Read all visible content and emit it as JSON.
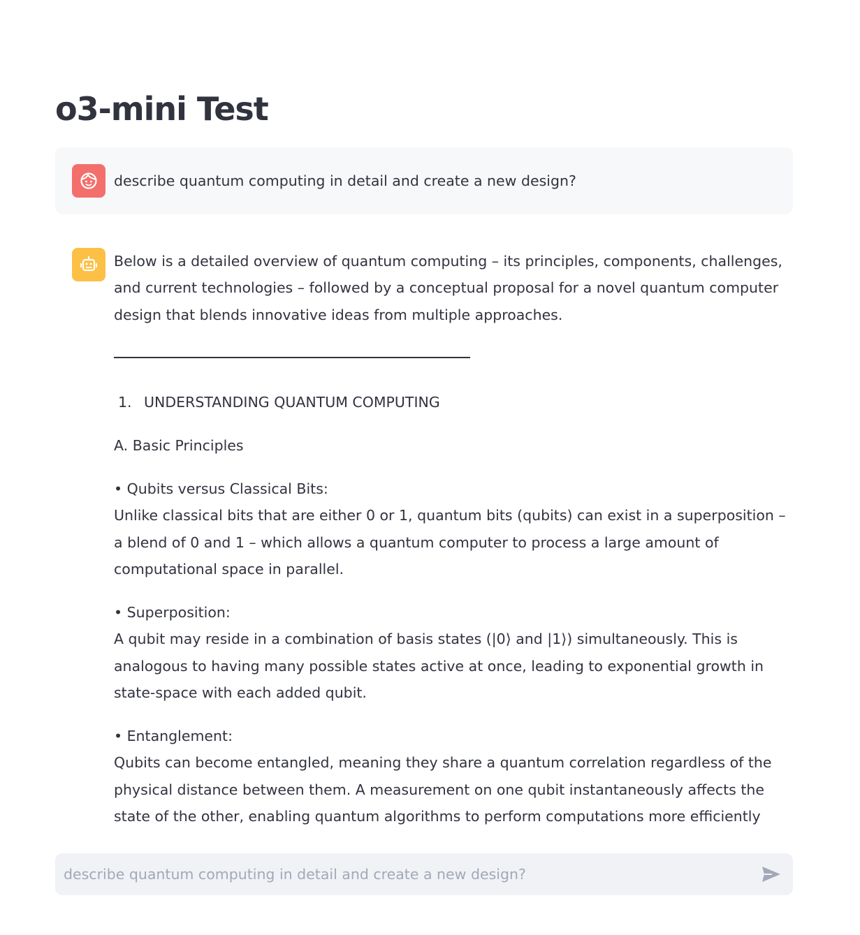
{
  "app": {
    "title": "o3-mini Test"
  },
  "colors": {
    "user_avatar": "#f36f6b",
    "bot_avatar": "#fcc046",
    "user_bubble": "#f7f8fa",
    "input_bg": "#f0f2f6",
    "text": "#31333f",
    "placeholder": "#a3a8b8"
  },
  "messages": {
    "user": {
      "avatar_icon": "face-icon",
      "text": "describe quantum computing in detail and create a new design?"
    },
    "assistant": {
      "avatar_icon": "robot-icon",
      "intro": "Below is a detailed overview of quantum computing – its principles, components, challenges, and current technologies – followed by a conceptual proposal for a novel quantum computer design that blends innovative ideas from multiple approaches.",
      "section_number": "1.",
      "section_title": "UNDERSTANDING QUANTUM COMPUTING",
      "subsection": "A. Basic Principles",
      "points": [
        {
          "heading": "• Qubits versus Classical Bits:",
          "body": "Unlike classical bits that are either 0 or 1, quantum bits (qubits) can exist in a superposition – a blend of 0 and 1 – which allows a quantum computer to process a large amount of computational space in parallel."
        },
        {
          "heading": "• Superposition:",
          "body": "A qubit may reside in a combination of basis states (|0⟩ and |1⟩) simultaneously. This is analogous to having many possible states active at once, leading to exponential growth in state-space with each added qubit."
        },
        {
          "heading": "• Entanglement:",
          "body": "Qubits can become entangled, meaning they share a quantum correlation regardless of the physical distance between them. A measurement on one qubit instantaneously affects the state of the other, enabling quantum algorithms to perform computations more efficiently than"
        }
      ]
    }
  },
  "chat_input": {
    "placeholder": "describe quantum computing in detail and create a new design?",
    "send_icon": "send-icon"
  }
}
